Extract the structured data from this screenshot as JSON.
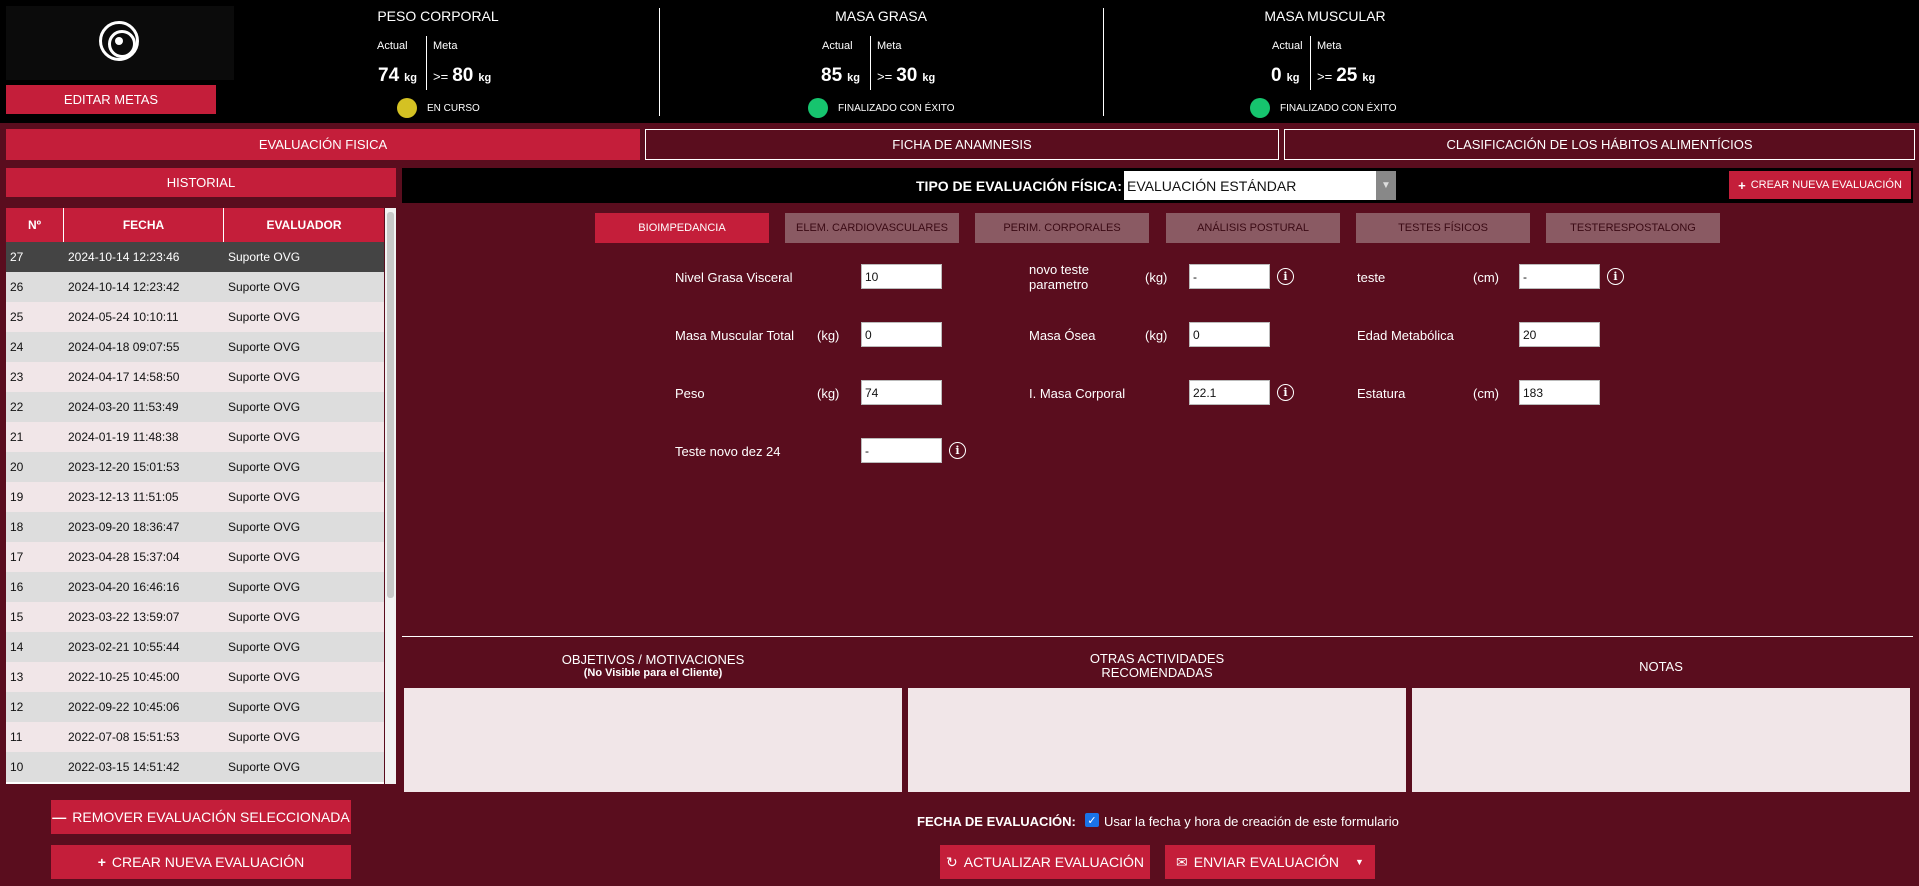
{
  "header": {
    "edit_goals": "EDITAR METAS",
    "metrics": [
      {
        "title": "PESO CORPORAL",
        "actual_label": "Actual",
        "meta_label": "Meta",
        "actual_value": "74",
        "actual_unit": "kg",
        "op": ">=",
        "meta_value": "80",
        "meta_unit": "kg",
        "status": "EN CURSO",
        "status_color": "#d4c123"
      },
      {
        "title": "MASA GRASA",
        "actual_label": "Actual",
        "meta_label": "Meta",
        "actual_value": "85",
        "actual_unit": "kg",
        "op": ">=",
        "meta_value": "30",
        "meta_unit": "kg",
        "status": "FINALIZADO CON ÉXITO",
        "status_color": "#16c46e"
      },
      {
        "title": "MASA MUSCULAR",
        "actual_label": "Actual",
        "meta_label": "Meta",
        "actual_value": "0",
        "actual_unit": "kg",
        "op": ">=",
        "meta_value": "25",
        "meta_unit": "kg",
        "status": "FINALIZADO CON ÉXITO",
        "status_color": "#16c46e"
      }
    ]
  },
  "tabs": [
    "EVALUACIÓN FISICA",
    "FICHA DE ANAMNESIS",
    "CLASIFICACIÓN DE LOS HÁBITOS ALIMENTÍCIOS"
  ],
  "historial": {
    "title": "HISTORIAL",
    "columns": [
      "Nº",
      "FECHA",
      "EVALUADOR"
    ],
    "rows": [
      {
        "n": "27",
        "fecha": "2024-10-14 12:23:46",
        "evaluador": "Suporte OVG"
      },
      {
        "n": "26",
        "fecha": "2024-10-14 12:23:42",
        "evaluador": "Suporte OVG"
      },
      {
        "n": "25",
        "fecha": "2024-05-24 10:10:11",
        "evaluador": "Suporte OVG"
      },
      {
        "n": "24",
        "fecha": "2024-04-18 09:07:55",
        "evaluador": "Suporte OVG"
      },
      {
        "n": "23",
        "fecha": "2024-04-17 14:58:50",
        "evaluador": "Suporte OVG"
      },
      {
        "n": "22",
        "fecha": "2024-03-20 11:53:49",
        "evaluador": "Suporte OVG"
      },
      {
        "n": "21",
        "fecha": "2024-01-19 11:48:38",
        "evaluador": "Suporte OVG"
      },
      {
        "n": "20",
        "fecha": "2023-12-20 15:01:53",
        "evaluador": "Suporte OVG"
      },
      {
        "n": "19",
        "fecha": "2023-12-13 11:51:05",
        "evaluador": "Suporte OVG"
      },
      {
        "n": "18",
        "fecha": "2023-09-20 18:36:47",
        "evaluador": "Suporte OVG"
      },
      {
        "n": "17",
        "fecha": "2023-04-28 15:37:04",
        "evaluador": "Suporte OVG"
      },
      {
        "n": "16",
        "fecha": "2023-04-20 16:46:16",
        "evaluador": "Suporte OVG"
      },
      {
        "n": "15",
        "fecha": "2023-03-22 13:59:07",
        "evaluador": "Suporte OVG"
      },
      {
        "n": "14",
        "fecha": "2023-02-21 10:55:44",
        "evaluador": "Suporte OVG"
      },
      {
        "n": "13",
        "fecha": "2022-10-25 10:45:00",
        "evaluador": "Suporte OVG"
      },
      {
        "n": "12",
        "fecha": "2022-09-22 10:45:06",
        "evaluador": "Suporte OVG"
      },
      {
        "n": "11",
        "fecha": "2022-07-08 15:51:53",
        "evaluador": "Suporte OVG"
      },
      {
        "n": "10",
        "fecha": "2022-03-15 14:51:42",
        "evaluador": "Suporte OVG"
      }
    ],
    "remove_btn": "REMOVER EVALUACIÓN SELECCIONADA",
    "create_btn": "CREAR NUEVA EVALUACIÓN"
  },
  "eval_type": {
    "label": "TIPO DE EVALUACIÓN FÍSICA:",
    "selected": "EVALUACIÓN ESTÁNDAR",
    "new_btn": "CREAR NUEVA EVALUACIÓN"
  },
  "subtabs": [
    "BIOIMPEDANCIA",
    "ELEM. CARDIOVASCULARES",
    "PERIM. CORPORALES",
    "ANÁLISIS POSTURAL",
    "TESTES FÍSICOS",
    "TESTERESPOSTALONG"
  ],
  "fields": {
    "nivel_grasa": {
      "label": "Nivel Grasa Visceral",
      "value": "10"
    },
    "novo_teste": {
      "label": "novo teste parametro",
      "unit": "(kg)",
      "value": "-"
    },
    "teste": {
      "label": "teste",
      "unit": "(cm)",
      "value": "-"
    },
    "masa_muscular": {
      "label": "Masa Muscular Total",
      "unit": "(kg)",
      "value": "0"
    },
    "masa_osea": {
      "label": "Masa Ósea",
      "unit": "(kg)",
      "value": "0"
    },
    "edad_metabolica": {
      "label": "Edad Metabólica",
      "value": "20"
    },
    "peso": {
      "label": "Peso",
      "unit": "(kg)",
      "value": "74"
    },
    "imc": {
      "label": "I. Masa Corporal",
      "value": "22.1"
    },
    "estatura": {
      "label": "Estatura",
      "unit": "(cm)",
      "value": "183"
    },
    "teste_novo": {
      "label": "Teste novo dez 24",
      "value": "-"
    }
  },
  "notes": {
    "objetivos": "OBJETIVOS / MOTIVACIONES",
    "objetivos_sub": "(No Visible para el Cliente)",
    "otras_1": "OTRAS ACTIVIDADES",
    "otras_2": "RECOMENDADAS",
    "notas": "NOTAS"
  },
  "footer": {
    "date_label": "FECHA DE EVALUACIÓN:",
    "checkbox_label": "Usar la fecha y hora de creación de este formulario",
    "update_btn": "ACTUALIZAR EVALUACIÓN",
    "send_btn": "ENVIAR EVALUACIÓN"
  }
}
